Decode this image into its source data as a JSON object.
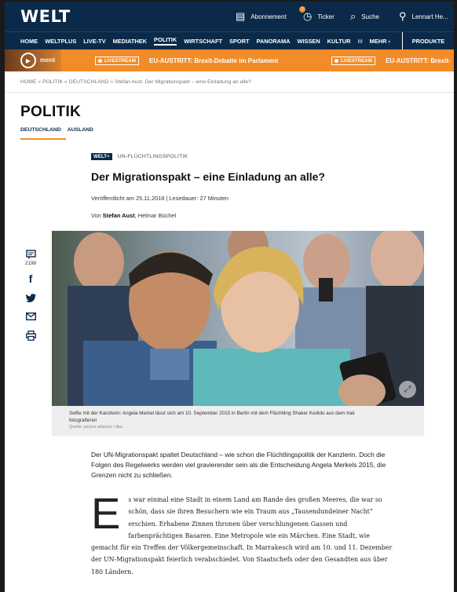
{
  "header": {
    "logo": "WELT",
    "subscription": "Abonnement",
    "ticker_label": "Ticker",
    "ticker_badge": "3",
    "search": "Suche",
    "user": "Lennart He..."
  },
  "nav": {
    "items": [
      "HOME",
      "WELTPLUS",
      "LIVE-TV",
      "MEDIATHEK",
      "POLITIK",
      "WIRTSCHAFT",
      "SPORT",
      "PANORAMA",
      "WISSEN",
      "KULTUR",
      "M",
      "MEHR ›"
    ],
    "products": "PRODUKTE"
  },
  "ticker": {
    "shadow_text": "ment",
    "items": [
      {
        "badge": "LIVESTREAM",
        "text": "EU-AUSTRITT: Brexit-Debatte im Parlament"
      },
      {
        "badge": "LIVESTREAM",
        "text": "EU-AUSTRITT: Brexit-"
      }
    ]
  },
  "breadcrumb": "HOME  »  POLITIK  »  DEUTSCHLAND  »  Stefan Aust: Der Migrationspakt – eine Einladung an alle?",
  "section": {
    "title": "POLITIK",
    "subnav": [
      "DEUTSCHLAND",
      "AUSLAND"
    ]
  },
  "article": {
    "badge": "WELT+",
    "topic": "UN-FLÜCHTLINGSPOLITIK",
    "headline": "Der Migrationspakt – eine Einladung an alle?",
    "meta": "Veröffentlicht am 25.11.2018 | Lesedauer: 27 Minuten",
    "authors_prefix": "Von ",
    "author_main": "Stefan Aust",
    "authors_rest": ", Helmar Büchel",
    "comment_count": "2198",
    "caption": "Selfie mit der Kanzlerin: Angela Merkel lässt sich am 10. September 2015 in Berlin mit dem Flüchtling Shaker Kedido aus dem Irak fotografieren",
    "credit": "Quelle: picture alliance / dpa",
    "lead": "Der UN-Migrationspakt spaltet Deutschland – wie schon die Flüchtlingspolitik der Kanzlerin. Doch die Folgen des Regelwerks werden viel gravierender sein als die Entscheidung Angela Merkels 2015, die Grenzen nicht zu schließen.",
    "dropcap": "E",
    "body": "s war einmal eine Stadt in einem Land am Rande des großen Meeres, die war so schön, dass sie ihren Besuchern wie ein Traum aus „Tausendundeiner Nacht“ erschien. Erhabene Zinnen thronen über verschlungenen Gassen und farbenprächtigen Basaren. Eine Metropole wie ein Märchen. Eine Stadt, wie gemacht für ein Treffen der Völkergemeinschaft. In Marrakesch wird am 10. und 11. Dezember der UN-Migrationspakt feierlich verabschiedet. Von Staatschefs oder den Gesandten aus über 180 Ländern."
  },
  "colors": {
    "navy": "#0b2a4a",
    "orange": "#f28c28"
  }
}
